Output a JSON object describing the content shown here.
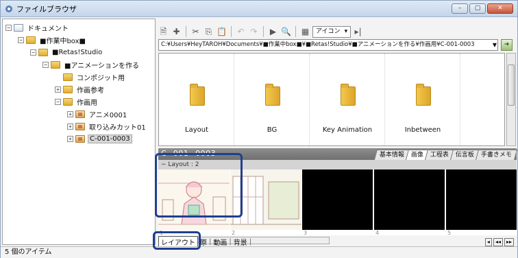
{
  "window": {
    "title": "ファイルブラウザ",
    "controls": [
      "–",
      "▢",
      "✕"
    ]
  },
  "tree": {
    "nodes": [
      {
        "label": "ドキュメント",
        "expander": "−",
        "icon": "document-folder-icon"
      },
      {
        "label": "■作業中box■",
        "expander": "−",
        "icon": "folder-icon"
      },
      {
        "label": "■Retas!Studio",
        "expander": "−",
        "icon": "folder-icon"
      },
      {
        "label": "■アニメーションを作る",
        "expander": "−",
        "icon": "folder-icon"
      },
      {
        "label": "コンポジット用",
        "expander": "",
        "icon": "folder-icon"
      },
      {
        "label": "作画参考",
        "expander": "+",
        "icon": "folder-icon"
      },
      {
        "label": "作画用",
        "expander": "−",
        "icon": "folder-icon"
      },
      {
        "label": "アニメ0001",
        "expander": "+",
        "icon": "cut-folder-icon"
      },
      {
        "label": "取り込みカット01",
        "expander": "+",
        "icon": "cut-folder-icon"
      },
      {
        "label": "C-001-0003",
        "expander": "+",
        "icon": "cut-folder-icon",
        "selected": true
      }
    ]
  },
  "toolbar": {
    "view_mode_label": "アイコン",
    "view_mode_arrow": "▾"
  },
  "path": {
    "value": "C:¥Users¥HeyTAROH¥Documents¥■作業中box■¥■Retas!Studio¥■アニメーションを作る¥作画用¥C-001-0003",
    "dropdown_arrow": "▼"
  },
  "folders": [
    {
      "label": "Layout"
    },
    {
      "label": "BG"
    },
    {
      "label": "Key Animation"
    },
    {
      "label": "Inbetween"
    }
  ],
  "cut": {
    "name": "C−001−0003",
    "detail_tabs": [
      {
        "label": "基本情報",
        "active": false
      },
      {
        "label": "画像",
        "active": true
      },
      {
        "label": "工程表",
        "active": false
      },
      {
        "label": "伝言板",
        "active": false
      },
      {
        "label": "手書きメモ",
        "active": false
      }
    ],
    "layer_header": "− Layout : 2"
  },
  "thumbnails": {
    "numbers": [
      "1",
      "2",
      "3",
      "4",
      "5"
    ],
    "nav_buttons": [
      "◂",
      "◂◂",
      "▸▸"
    ]
  },
  "bottom_tabs": [
    {
      "label": "レイアウト",
      "active": true
    },
    {
      "label": "原",
      "active": false
    },
    {
      "label": "動画",
      "active": false
    },
    {
      "label": "背景",
      "active": false
    }
  ],
  "status": {
    "text": "5 個のアイテム"
  },
  "colors": {
    "highlight": "#1f3f8f",
    "folder": "#e1ae30",
    "cut_bar": "#7a7a7a"
  }
}
